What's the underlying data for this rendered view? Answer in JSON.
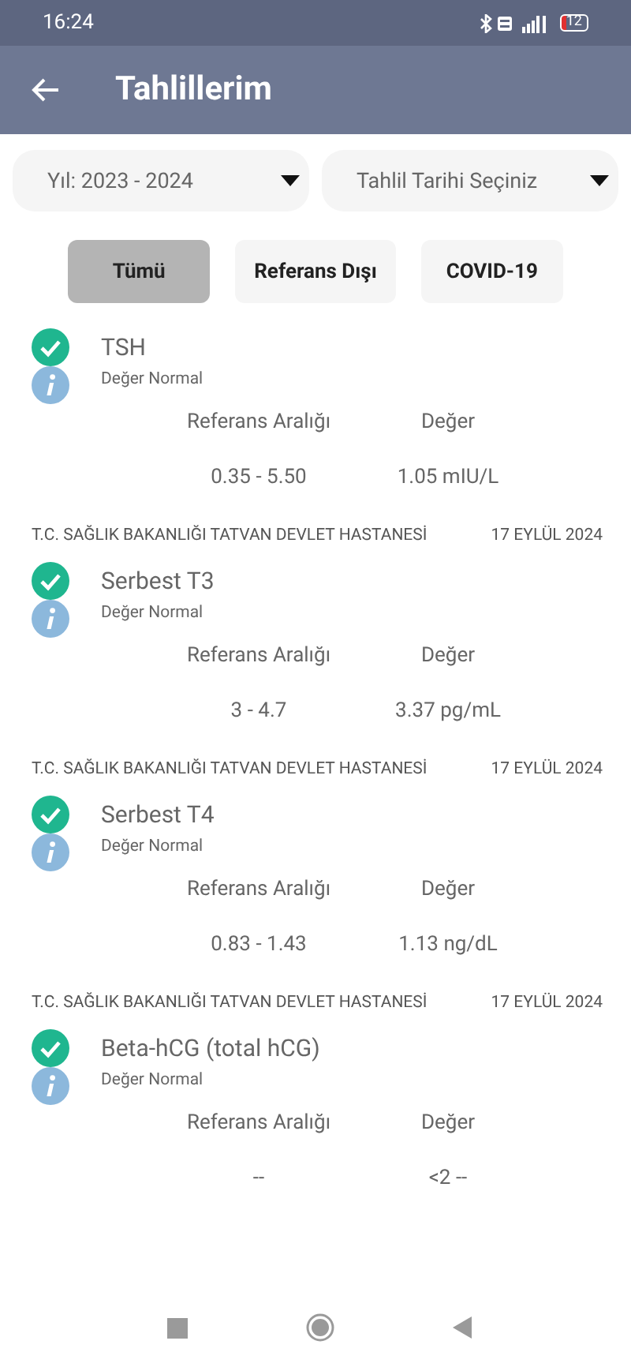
{
  "status_bar": {
    "time": "16:24",
    "battery": "12"
  },
  "app_bar": {
    "title": "Tahlillerim"
  },
  "dropdowns": [
    {
      "label": "Yıl: 2023 - 2024"
    },
    {
      "label": "Tahlil Tarihi Seçiniz"
    }
  ],
  "filters": [
    {
      "label": "Tümü",
      "selected": true
    },
    {
      "label": "Referans Dışı",
      "selected": false
    },
    {
      "label": "COVID-19",
      "selected": false
    }
  ],
  "results": [
    {
      "name": "TSH",
      "status": "Değer Normal",
      "range_label": "Referans Aralığı",
      "value_label": "Değer",
      "range": "0.35 - 5.50",
      "value": "1.05 mIU/L"
    },
    {
      "hospital": "T.C. SAĞLIK BAKANLIĞI TATVAN DEVLET HASTANESİ",
      "date": "17 EYLÜL 2024",
      "name": "Serbest T3",
      "status": "Değer Normal",
      "range_label": "Referans Aralığı",
      "value_label": "Değer",
      "range": "3 - 4.7",
      "value": "3.37 pg/mL"
    },
    {
      "hospital": "T.C. SAĞLIK BAKANLIĞI TATVAN DEVLET HASTANESİ",
      "date": "17 EYLÜL 2024",
      "name": "Serbest T4",
      "status": "Değer Normal",
      "range_label": "Referans Aralığı",
      "value_label": "Değer",
      "range": "0.83 - 1.43",
      "value": "1.13 ng/dL"
    },
    {
      "hospital": "T.C. SAĞLIK BAKANLIĞI TATVAN DEVLET HASTANESİ",
      "date": "17 EYLÜL 2024",
      "name": "Beta-hCG (total hCG)",
      "status": "Değer Normal",
      "range_label": "Referans Aralığı",
      "value_label": "Değer",
      "range": "--",
      "value": "<2 --"
    }
  ]
}
